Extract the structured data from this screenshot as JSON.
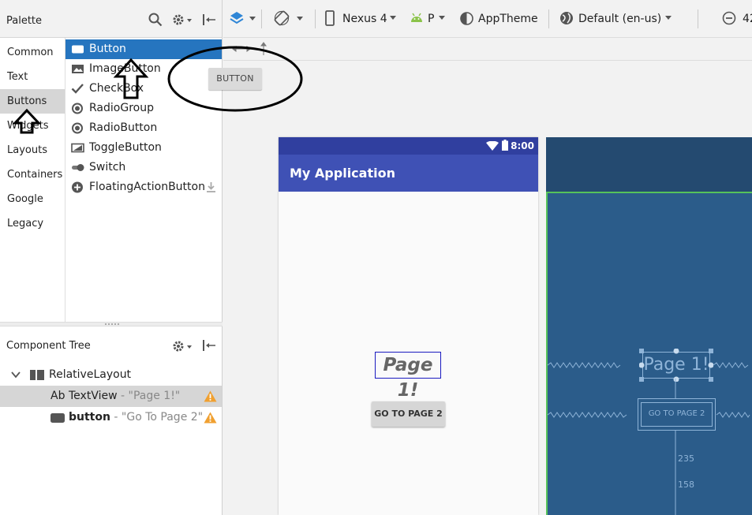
{
  "palette": {
    "title": "Palette",
    "categories": [
      {
        "label": "Common"
      },
      {
        "label": "Text"
      },
      {
        "label": "Buttons"
      },
      {
        "label": "Widgets"
      },
      {
        "label": "Layouts"
      },
      {
        "label": "Containers"
      },
      {
        "label": "Google"
      },
      {
        "label": "Legacy"
      }
    ],
    "selected_category": "Buttons",
    "widgets": [
      {
        "label": "Button",
        "icon": "button-icon"
      },
      {
        "label": "ImageButton",
        "icon": "image-icon"
      },
      {
        "label": "CheckBox",
        "icon": "check-icon"
      },
      {
        "label": "RadioGroup",
        "icon": "radio-icon"
      },
      {
        "label": "RadioButton",
        "icon": "radio-icon"
      },
      {
        "label": "ToggleButton",
        "icon": "toggle-icon"
      },
      {
        "label": "Switch",
        "icon": "switch-icon"
      },
      {
        "label": "FloatingActionButton",
        "icon": "plus-circle-icon"
      }
    ],
    "selected_widget": "Button"
  },
  "component_tree": {
    "title": "Component Tree",
    "root": "RelativeLayout",
    "children": [
      {
        "icon_text": "Ab",
        "name": "TextView",
        "detail": " - \"Page 1!\""
      },
      {
        "name": "button",
        "detail": " - \"Go To Page 2\""
      }
    ]
  },
  "toolbar": {
    "device": "Nexus 4",
    "api": "P",
    "theme": "AppTheme",
    "locale": "Default (en-us)",
    "zoom_partial": "42"
  },
  "drag_preview": {
    "label": "BUTTON"
  },
  "design": {
    "status_time": "8:00",
    "app_title": "My Application",
    "page_text": "Page 1!",
    "button_label": "GO TO PAGE 2"
  },
  "blueprint": {
    "page_text": "Page 1!",
    "button_label": "GO TO PAGE 2",
    "margin_1": "235",
    "margin_2": "158"
  },
  "colors": {
    "selection_blue": "#2675bf",
    "primary": "#3f51b5",
    "primary_dark": "#303f9f",
    "blueprint_bg": "#2b5c8a",
    "warning": "#f0a030"
  }
}
